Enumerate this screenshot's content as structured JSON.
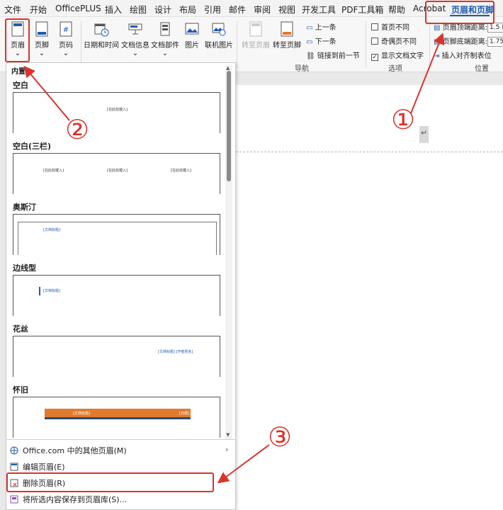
{
  "menubar": {
    "items": [
      "文件",
      "开始",
      "OfficePLUS",
      "插入",
      "绘图",
      "设计",
      "布局",
      "引用",
      "邮件",
      "审阅",
      "视图",
      "开发工具",
      "PDF工具箱",
      "帮助",
      "Acrobat",
      "页眉和页脚"
    ]
  },
  "ribbon": {
    "header_btn": "页眉",
    "footer_btn": "页脚",
    "pagenum_btn": "页码",
    "datetime_btn": "日期和时间",
    "docinfo_btn": "文档信息",
    "docparts_btn": "文档部件",
    "picture_btn": "图片",
    "online_pic_btn": "联机图片",
    "goto_header_btn": "转至页眉",
    "goto_footer_btn": "转至页脚",
    "prev_btn": "上一条",
    "next_btn": "下一条",
    "link_prev_btn": "链接到前一节",
    "nav_group": "导航",
    "diff_first": "首页不同",
    "diff_odd_even": "奇偶页不同",
    "show_doc_text": "显示文档文字",
    "options_group": "选项",
    "header_top_dist": "页眉顶端距离:",
    "header_top_val": "1.5 厘",
    "footer_bottom_dist": "页脚底端距离:",
    "footer_bottom_val": "1.75",
    "insert_align_tab": "插入对齐制表位",
    "position_group": "位置"
  },
  "document": {
    "para_mark": "↵"
  },
  "gallery": {
    "builtin_label": "内置",
    "sections": [
      {
        "name": "空白",
        "placeholders": [
          "[在此处键入]"
        ]
      },
      {
        "name": "空白(三栏)",
        "placeholders": [
          "[在此处键入]",
          "[在此处键入]",
          "[在此处键入]"
        ]
      },
      {
        "name": "奥斯汀",
        "placeholders": [
          "[文档标题]"
        ]
      },
      {
        "name": "边线型",
        "placeholders": [
          "[文档标题]"
        ]
      },
      {
        "name": "花丝",
        "placeholders": [
          "[文档标题] [作者姓名]"
        ]
      },
      {
        "name": "怀旧",
        "placeholders": [
          "[文档标题]",
          "[日期]"
        ]
      }
    ]
  },
  "footer_menu": {
    "more_headers": "Office.com 中的其他页眉(M)",
    "edit_header": "编辑页眉(E)",
    "delete_header": "删除页眉(R)",
    "save_selection": "将所选内容保存到页眉库(S)..."
  },
  "callouts": {
    "one": "①",
    "two": "②",
    "three": "③"
  },
  "colors": {
    "accent": "#1f5bb5",
    "annotation": "#d9342b",
    "vintage_bar": "#e07a2f"
  }
}
